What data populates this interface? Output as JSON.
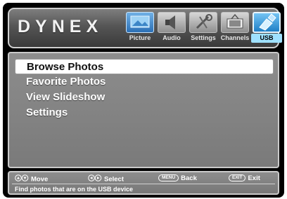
{
  "header": {
    "logo": "DYNEX",
    "tabs": [
      {
        "label": "Picture",
        "icon": "picture-icon"
      },
      {
        "label": "Audio",
        "icon": "audio-icon"
      },
      {
        "label": "Settings",
        "icon": "settings-icon"
      },
      {
        "label": "Channels",
        "icon": "channels-icon"
      },
      {
        "label": "USB",
        "icon": "usb-icon",
        "selected": true
      }
    ]
  },
  "menu": {
    "items": [
      {
        "label": "Browse Photos",
        "selected": true
      },
      {
        "label": "Favorite Photos"
      },
      {
        "label": "View Slideshow"
      },
      {
        "label": "Settings"
      }
    ]
  },
  "footer": {
    "hints": [
      {
        "key": "up-down-arrows-icon",
        "label": "Move"
      },
      {
        "key": "left-right-arrows-icon",
        "label": "Select"
      },
      {
        "key": "MENU",
        "label": "Back"
      },
      {
        "key": "EXIT",
        "label": "Exit"
      }
    ],
    "help_text": "Find photos that are on the USB device"
  },
  "colors": {
    "selected_tab": "#9fe1ff",
    "selected_item_bg": "#ffffff",
    "panel_bg": "#858585"
  }
}
